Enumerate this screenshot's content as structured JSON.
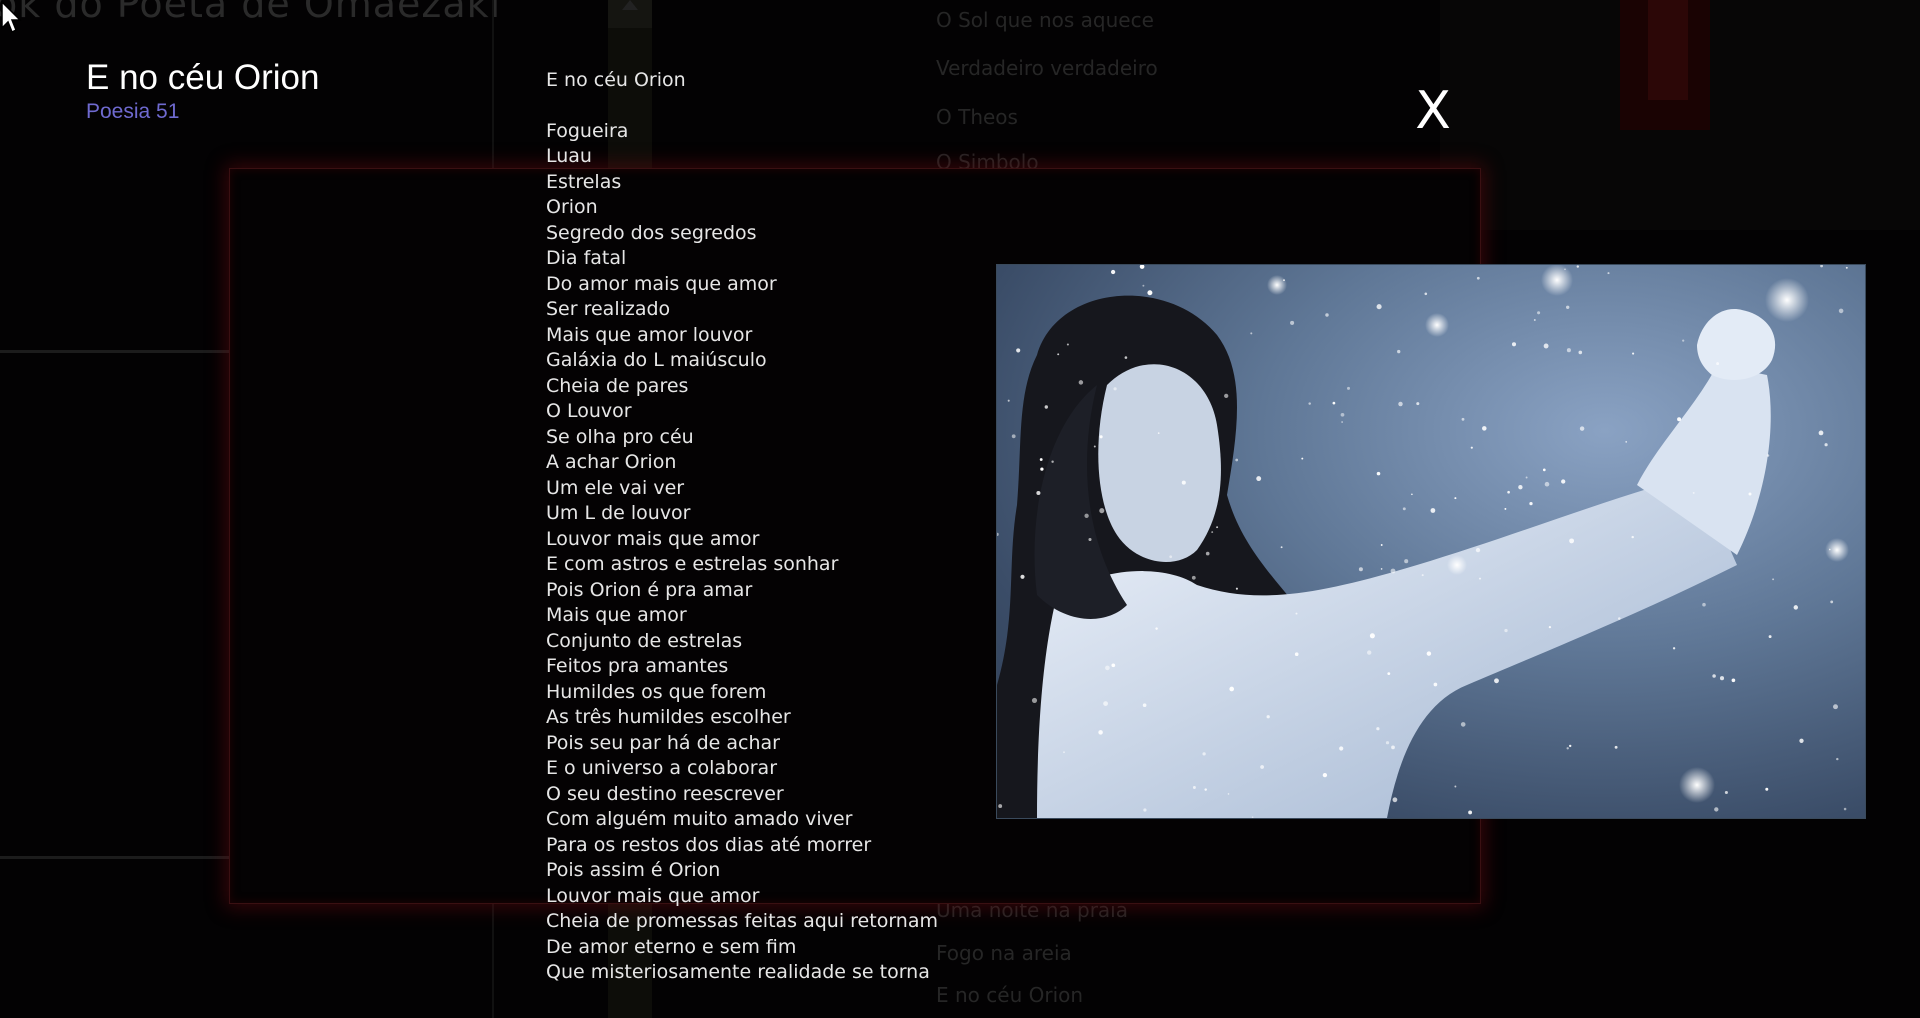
{
  "background": {
    "app_title": "ok do Poeta de Omaezaki",
    "list_items": [
      "O Sol que nos aquece",
      "Verdadeiro  verdadeiro",
      "O Theos",
      "O Simbolo",
      "Uma noite na praia",
      "Fogo na areia",
      "E no céu Orion"
    ]
  },
  "poem": {
    "title": "E no céu Orion",
    "subtitle": "Poesia 51",
    "heading": "E no céu Orion",
    "lines": [
      "Fogueira",
      "Luau",
      "Estrelas",
      "Orion",
      "Segredo dos segredos",
      "Dia fatal",
      "Do amor mais que amor",
      "Ser realizado",
      "Mais que amor louvor",
      "Galáxia do L maiúsculo",
      "Cheia de pares",
      "O Louvor",
      "Se olha pro céu",
      "A achar Orion",
      "Um ele vai ver",
      "Um L de louvor",
      "Louvor mais que amor",
      "E com astros e estrelas sonhar",
      "Pois Orion é pra amar",
      "Mais que amor",
      "Conjunto de estrelas",
      "Feitos pra amantes",
      "Humildes os que forem",
      "As três humildes escolher",
      "Pois seu par há de achar",
      "E o universo a colaborar",
      "O seu destino reescrever",
      "Com alguém muito amado viver",
      "Para os restos dos dias até morrer",
      "Pois assim é Orion",
      "Louvor mais que amor",
      "Cheia de promessas feitas aqui retornam",
      "De amor eterno e sem fim",
      "Que misteriosamente realidade se torna"
    ]
  },
  "modal": {
    "close_label": "X"
  },
  "colors": {
    "subtitle": "#6f6ad0",
    "frame_glow": "#6e0a0f",
    "photo_tint": "#5f7796"
  }
}
